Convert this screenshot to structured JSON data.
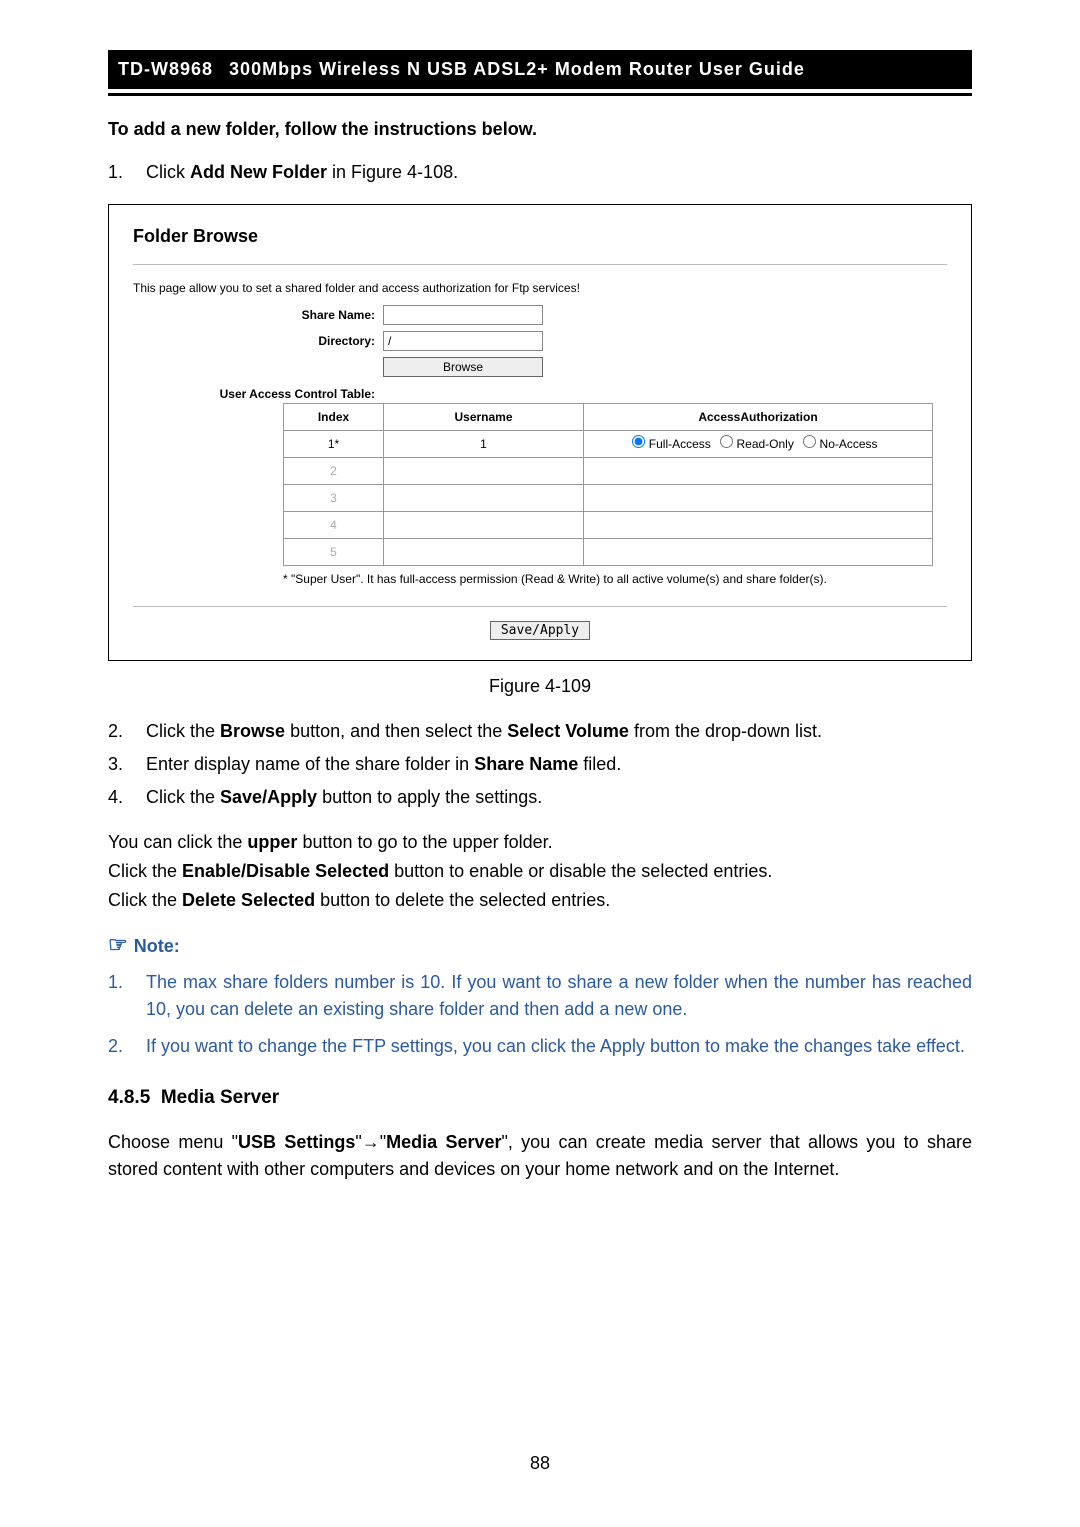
{
  "header": {
    "model": "TD-W8968",
    "title": "300Mbps  Wireless  N  USB  ADSL2+  Modem  Router  User  Guide"
  },
  "intro": "To add a new folder, follow the instructions below.",
  "step1": {
    "num": "1.",
    "pre": "Click ",
    "bold": "Add New Folder",
    "post": " in Figure 4-108."
  },
  "figure": {
    "title": "Folder Browse",
    "desc": "This page allow you to set a shared folder and access authorization for Ftp services!",
    "share_name_label": "Share Name:",
    "share_name_value": "",
    "directory_label": "Directory:",
    "directory_value": "/",
    "browse_button": "Browse",
    "uact_label": "User Access Control Table:",
    "columns": {
      "index": "Index",
      "username": "Username",
      "access": "AccessAuthorization"
    },
    "rows": [
      {
        "index": "1*",
        "username": "1",
        "grey": false
      },
      {
        "index": "2",
        "username": "",
        "grey": true
      },
      {
        "index": "3",
        "username": "",
        "grey": true
      },
      {
        "index": "4",
        "username": "",
        "grey": true
      },
      {
        "index": "5",
        "username": "",
        "grey": true
      }
    ],
    "access_options": {
      "full": "Full-Access",
      "read": "Read-Only",
      "no": "No-Access"
    },
    "footnote": "*  \"Super User\". It has full-access permission (Read & Write) to all active volume(s) and share folder(s).",
    "save_apply": "Save/Apply",
    "caption": "Figure 4-109"
  },
  "steps_after": [
    {
      "num": "2.",
      "parts": [
        "Click the ",
        "Browse",
        " button, and then select the ",
        "Select Volume",
        " from the drop-down list."
      ]
    },
    {
      "num": "3.",
      "parts": [
        "Enter display name of the share folder in ",
        "Share Name",
        " filed."
      ]
    },
    {
      "num": "4.",
      "parts": [
        "Click the ",
        "Save/Apply",
        " button to apply the settings."
      ]
    }
  ],
  "body_lines": [
    {
      "pre": "You can click the ",
      "bold": "upper",
      "post": " button to go to the upper folder."
    },
    {
      "pre": "Click the ",
      "bold": "Enable/Disable Selected",
      "post": " button to enable or disable the selected entries."
    },
    {
      "pre": "Click the ",
      "bold": "Delete Selected",
      "post": " button to delete the selected entries."
    }
  ],
  "note_heading": "Note:",
  "notes": [
    {
      "num": "1.",
      "text": "The max share folders number is 10. If you want to share a new folder when the number has reached 10, you can delete an existing share folder and then add a new one."
    },
    {
      "num": "2.",
      "text": "If you want to change the FTP settings, you can click the Apply button to make the changes take effect."
    }
  ],
  "section": {
    "number": "4.8.5",
    "title": "Media Server",
    "para_parts": [
      "Choose menu \"",
      "USB Settings",
      "\"→\"",
      "Media Server",
      "\", you can create media server that allows you to share stored content with other computers and devices on your home network and on the Internet."
    ]
  },
  "page_number": "88"
}
